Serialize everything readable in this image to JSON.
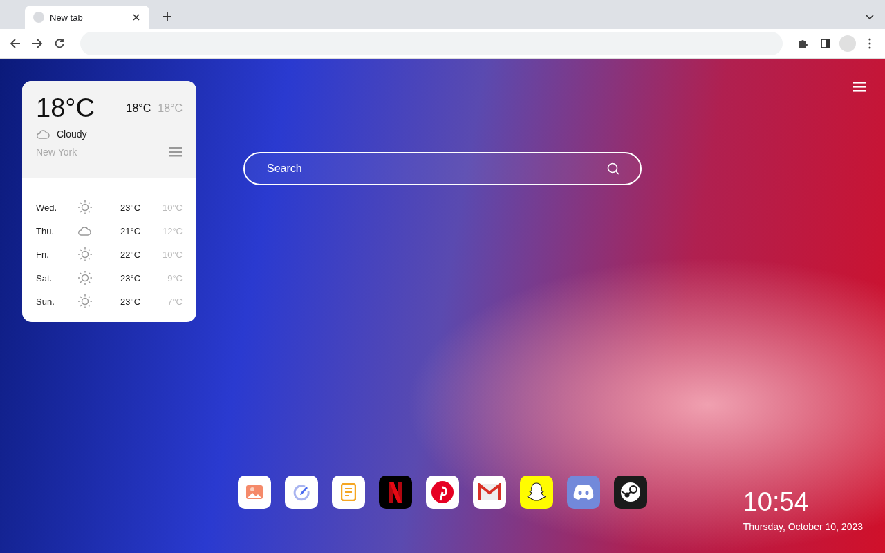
{
  "tabs": [
    {
      "title": "New tab",
      "selected": true
    }
  ],
  "weather": {
    "temperature": "18°C",
    "high": "18°C",
    "low": "18°C",
    "condition": {
      "kind": "cloudy",
      "label": "Cloudy"
    },
    "location": "New York",
    "forecast": [
      {
        "day": "Wed.",
        "kind": "sunny",
        "high": "23°C",
        "low": "10°C"
      },
      {
        "day": "Thu.",
        "kind": "cloudy",
        "high": "21°C",
        "low": "12°C"
      },
      {
        "day": "Fri.",
        "kind": "sunny",
        "high": "22°C",
        "low": "10°C"
      },
      {
        "day": "Sat.",
        "kind": "sunny",
        "high": "23°C",
        "low": "9°C"
      },
      {
        "day": "Sun.",
        "kind": "sunny",
        "high": "23°C",
        "low": "7°C"
      }
    ]
  },
  "search": {
    "placeholder": "Search"
  },
  "shortcuts": [
    {
      "kind": "gallery"
    },
    {
      "kind": "edit"
    },
    {
      "kind": "notes"
    },
    {
      "kind": "netflix"
    },
    {
      "kind": "pinterest"
    },
    {
      "kind": "gmail"
    },
    {
      "kind": "snapchat"
    },
    {
      "kind": "discord"
    },
    {
      "kind": "steam"
    }
  ],
  "clock": {
    "time": "10:54",
    "date": "Thursday, October 10, 2023"
  }
}
